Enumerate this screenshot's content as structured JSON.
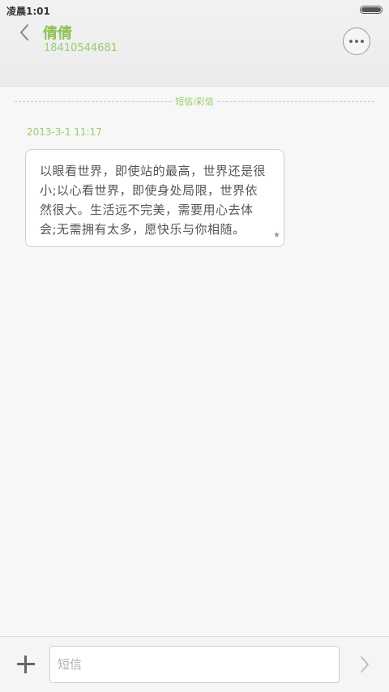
{
  "status_bar": {
    "time": "凌晨1:01"
  },
  "header": {
    "contact_name": "倩倩",
    "contact_number": "18410544681",
    "icons": [
      "back-chevron-icon",
      "more-icon"
    ]
  },
  "thread": {
    "divider_label": "短信/彩信",
    "messages": [
      {
        "timestamp": "2013-3-1 11:17",
        "text": "以眼看世界，即使站的最高，世界还是很小;以心看世界，即使身处局限，世界依然很大。生活远不完美，需要用心去体会;无需拥有太多，愿快乐与你相随。",
        "star": "★"
      }
    ]
  },
  "composer": {
    "placeholder": "短信",
    "value": "",
    "icons": [
      "plus-icon",
      "send-arrow-icon"
    ]
  },
  "colors": {
    "accent": "#8cc152",
    "header_bg": "#efefef",
    "background": "#f7f7f7"
  }
}
